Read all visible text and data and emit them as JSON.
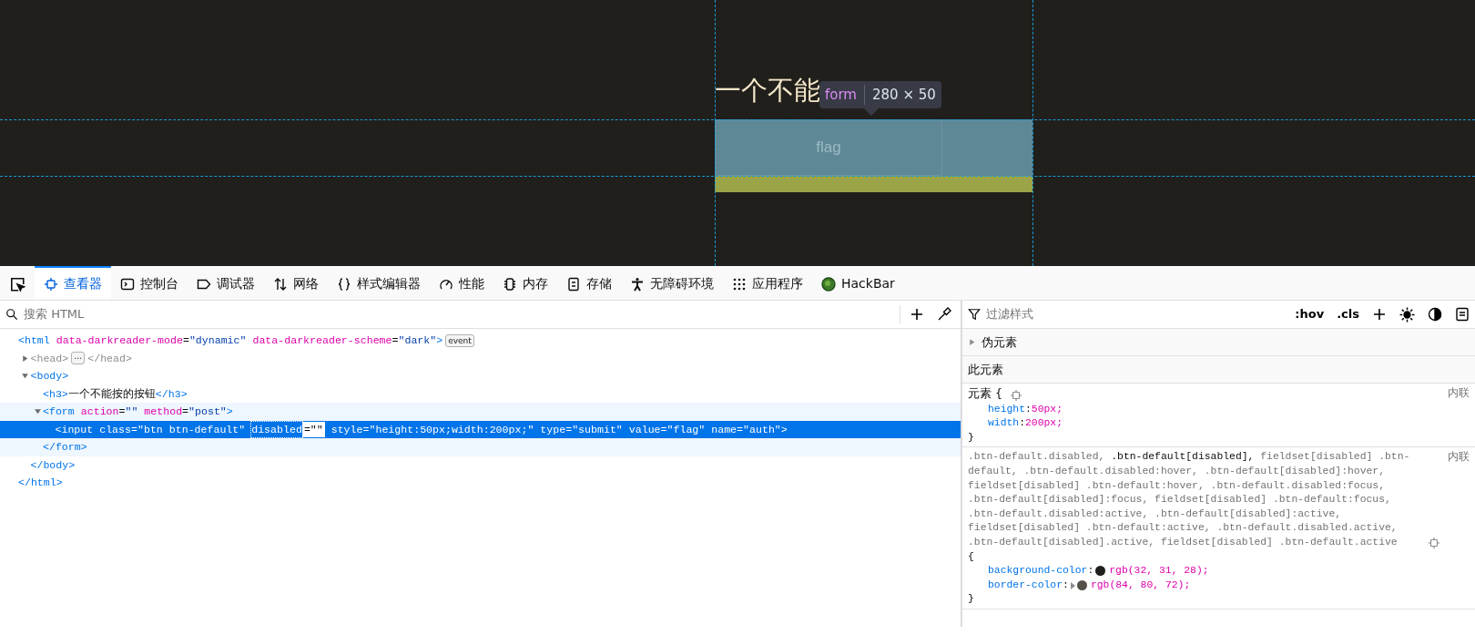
{
  "page": {
    "heading": "一个不能",
    "tooltip": {
      "tag": "form",
      "size": "280 × 50"
    },
    "button": {
      "value": "flag",
      "disabled": true
    }
  },
  "toolbar": {
    "tabs": [
      {
        "label": "查看器",
        "selected": true
      },
      {
        "label": "控制台",
        "selected": false
      },
      {
        "label": "调试器",
        "selected": false
      },
      {
        "label": "网络",
        "selected": false
      },
      {
        "label": "样式编辑器",
        "selected": false
      },
      {
        "label": "性能",
        "selected": false
      },
      {
        "label": "内存",
        "selected": false
      },
      {
        "label": "存储",
        "selected": false
      },
      {
        "label": "无障碍环境",
        "selected": false
      },
      {
        "label": "应用程序",
        "selected": false
      },
      {
        "label": "HackBar",
        "selected": false
      }
    ]
  },
  "inspector": {
    "search": {
      "placeholder": "搜索 HTML"
    },
    "tree": [
      {
        "open": [
          {
            "kind": "tag",
            "s": "<html"
          },
          {
            "kind": "attr",
            "s": " data-darkreader-mode"
          },
          {
            "kind": "punct",
            "s": "="
          },
          {
            "kind": "val",
            "s": "\"dynamic\""
          },
          {
            "kind": "attr",
            "s": " data-darkreader-scheme"
          },
          {
            "kind": "punct",
            "s": "="
          },
          {
            "kind": "val",
            "s": "\"dark\""
          },
          {
            "kind": "tag",
            "s": ">"
          },
          {
            "kind": "badge",
            "s": "event"
          }
        ],
        "selected": false,
        "children": [
          {
            "open": [
              {
                "kind": "dim",
                "s": "<head>"
              },
              {
                "kind": "badge",
                "s": "⋯"
              },
              {
                "kind": "dim",
                "s": "</head>"
              }
            ],
            "expanded": false,
            "selected": false
          },
          {
            "open": [
              {
                "kind": "tag",
                "s": "<body>"
              }
            ],
            "expanded": true,
            "selected": false,
            "children": [
              {
                "open": [
                  {
                    "kind": "tag",
                    "s": "<h3>"
                  },
                  {
                    "kind": "text",
                    "s": "一个不能按的按钮"
                  },
                  {
                    "kind": "tag",
                    "s": "</h3>"
                  }
                ],
                "selected": false
              },
              {
                "open": [
                  {
                    "kind": "tag",
                    "s": "<form"
                  },
                  {
                    "kind": "attr",
                    "s": " action"
                  },
                  {
                    "kind": "punct",
                    "s": "="
                  },
                  {
                    "kind": "val",
                    "s": "\"\""
                  },
                  {
                    "kind": "attr",
                    "s": " method"
                  },
                  {
                    "kind": "punct",
                    "s": "="
                  },
                  {
                    "kind": "val",
                    "s": "\"post\""
                  },
                  {
                    "kind": "tag",
                    "s": ">"
                  }
                ],
                "expanded": true,
                "selected": false,
                "hovered": true,
                "children": [
                  {
                    "open": [
                      {
                        "kind": "tag",
                        "s": "<input"
                      },
                      {
                        "kind": "attr",
                        "s": " class"
                      },
                      {
                        "kind": "punct",
                        "s": "="
                      },
                      {
                        "kind": "val",
                        "s": "\"btn btn-default\" "
                      },
                      {
                        "kind": "focus",
                        "s": "disabled"
                      },
                      {
                        "kind": "edit",
                        "s": "=\"\""
                      },
                      {
                        "kind": "attr",
                        "s": " style"
                      },
                      {
                        "kind": "punct",
                        "s": "="
                      },
                      {
                        "kind": "val",
                        "s": "\"height:50px;width:200px;\""
                      },
                      {
                        "kind": "attr",
                        "s": " type"
                      },
                      {
                        "kind": "punct",
                        "s": "="
                      },
                      {
                        "kind": "val",
                        "s": "\"submit\""
                      },
                      {
                        "kind": "attr",
                        "s": " value"
                      },
                      {
                        "kind": "punct",
                        "s": "="
                      },
                      {
                        "kind": "val",
                        "s": "\"flag\""
                      },
                      {
                        "kind": "attr",
                        "s": " name"
                      },
                      {
                        "kind": "punct",
                        "s": "="
                      },
                      {
                        "kind": "val",
                        "s": "\"auth\""
                      },
                      {
                        "kind": "tag",
                        "s": ">"
                      }
                    ],
                    "selected": true
                  }
                ],
                "close": [
                  {
                    "kind": "tag",
                    "s": "</form>"
                  }
                ]
              }
            ],
            "close": [
              {
                "kind": "tag",
                "s": "</body>"
              }
            ]
          }
        ],
        "close": [
          {
            "kind": "tag",
            "s": "</html>"
          }
        ]
      }
    ]
  },
  "rules": {
    "filter": {
      "placeholder": "过滤样式"
    },
    "toggles": [
      ":hov",
      ".cls"
    ],
    "sections": [
      {
        "label": "伪元素",
        "expanded": false
      },
      {
        "label": "此元素"
      }
    ],
    "rules": [
      {
        "selector": [
          {
            "s": "元素 {",
            "matched": true
          }
        ],
        "source": "内联",
        "declarations": [
          {
            "prop": "height",
            "punct": ":",
            "value": "50px;"
          },
          {
            "prop": "width",
            "punct": ":",
            "value": "200px;"
          }
        ],
        "close": "}"
      },
      {
        "selector": [
          {
            "s": ".btn-default.disabled, ",
            "matched": false
          },
          {
            "s": ".btn-default[disabled],",
            "matched": true
          },
          {
            "s": " fieldset[disabled] .btn-default, .btn-default.disabled:hover, .btn-default[disabled]:hover, fieldset[disabled] .btn-default:hover, .btn-default.disabled:focus, .btn-default[disabled]:focus, fieldset[disabled] .btn-default:focus, .btn-default.disabled:active, .btn-default[disabled]:active, fieldset[disabled] .btn-default:active, .btn-default.disabled.active, .btn-default[disabled].active, fieldset[disabled] .btn-default.active",
            "matched": false
          }
        ],
        "source": "内联",
        "open": "{",
        "declarations": [
          {
            "prop": "background-color",
            "punct": ":",
            "value": "rgb(32, 31, 28);",
            "color": "#201f1c",
            "expandable": false
          },
          {
            "prop": "border-color",
            "punct": ":",
            "value": "rgb(84, 80, 72);",
            "color": "#545048",
            "expandable": true
          }
        ],
        "close": "}"
      }
    ]
  }
}
